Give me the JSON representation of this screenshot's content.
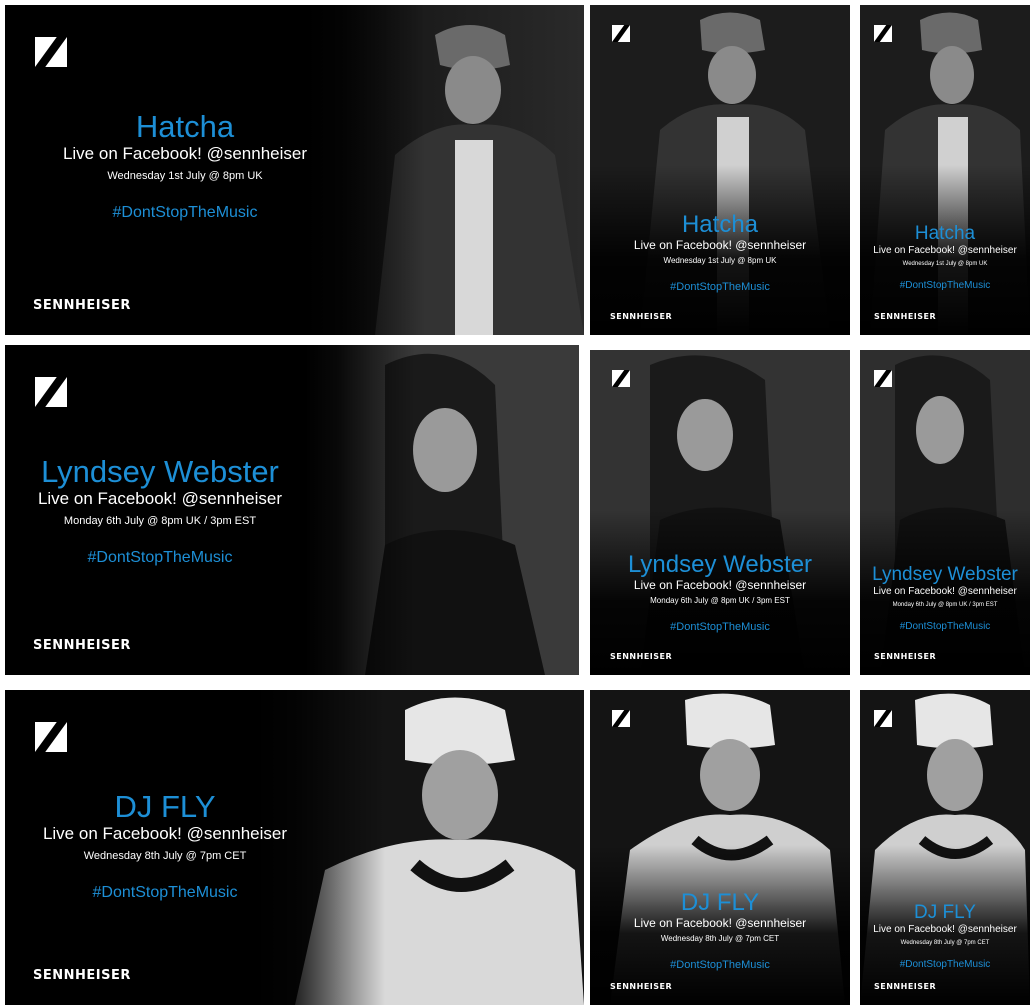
{
  "brand": "SENNHEISER",
  "hashtag": "#DontStopTheMusic",
  "subtitle": "Live on Facebook! @sennheiser",
  "accent_color": "#1d8fd6",
  "background_color": "#000000",
  "logo_icon": "sennheiser-logo-icon",
  "rows": [
    {
      "artist": "Hatcha",
      "date": "Wednesday 1st July @ 8pm UK",
      "photo": "man-in-cap-and-camo-jacket"
    },
    {
      "artist": "Lyndsey Webster",
      "date": "Monday 6th July @ 8pm UK / 3pm EST",
      "photo": "woman-with-long-hair"
    },
    {
      "artist": "DJ FLY",
      "date": "Wednesday 8th July @ 7pm CET",
      "photo": "man-in-white-cap-with-headphones"
    }
  ]
}
